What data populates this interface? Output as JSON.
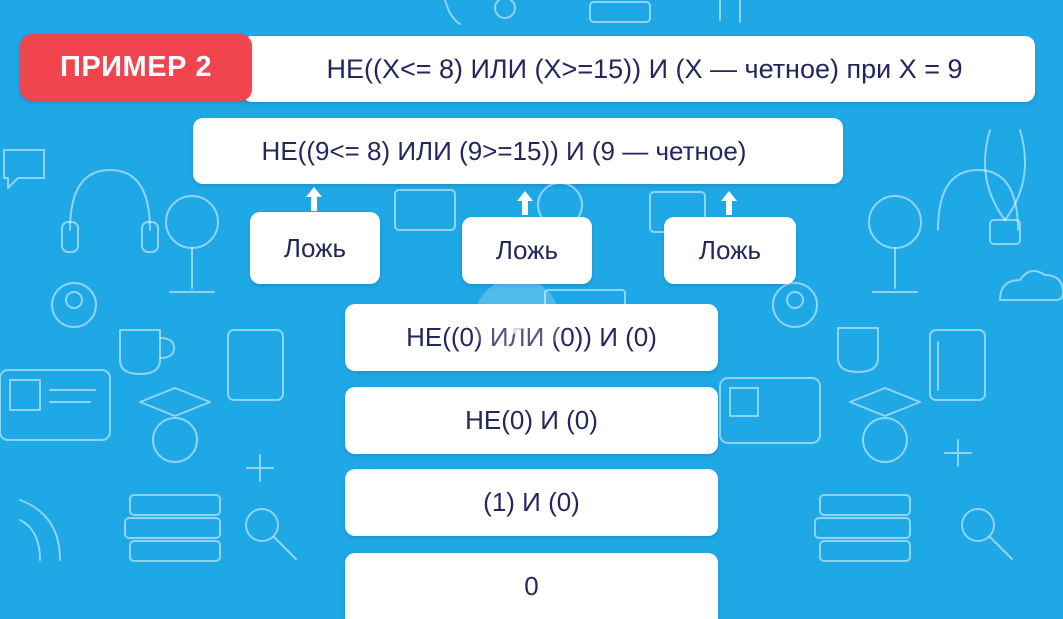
{
  "badge": {
    "label": "ПРИМЕР 2"
  },
  "condition": {
    "text": "НЕ((X<= 8) ИЛИ (X>=15)) И (X — четное) при X = 9"
  },
  "substituted": {
    "text": "НЕ((9<= 8) ИЛИ (9>=15)) И (9 — четное)"
  },
  "results": [
    {
      "label": "Ложь"
    },
    {
      "label": "Ложь"
    },
    {
      "label": "Ложь"
    }
  ],
  "steps": [
    {
      "text": "НЕ((0) ИЛИ (0)) И (0)"
    },
    {
      "text": "НЕ(0) И (0)"
    },
    {
      "text": "(1) И (0)"
    },
    {
      "text": "0"
    }
  ],
  "colors": {
    "background": "#1fa8e6",
    "badge": "#f0444f",
    "box": "#ffffff",
    "text": "#24275e"
  },
  "icons": [
    "arrow-up-icon",
    "play-icon",
    "doodle-background"
  ]
}
